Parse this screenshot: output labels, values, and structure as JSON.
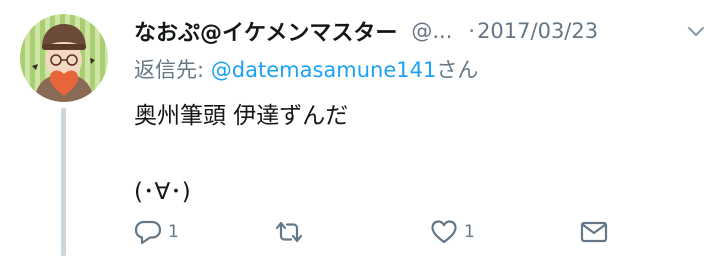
{
  "tweet": {
    "display_name": "なおぷ@イケメンマスター",
    "handle": "@...",
    "separator": "·",
    "date": "2017/03/23",
    "reply_prefix": "返信先: ",
    "reply_to": "@datemasamune141",
    "reply_suffix": "さん",
    "text_lines": [
      "奥州筆頭 伊達ずんだ",
      "(･∀･)"
    ]
  },
  "actions": {
    "reply_count": "1",
    "retweet_count": "",
    "like_count": "1"
  },
  "colors": {
    "text": "#14171a",
    "secondary": "#657786",
    "link": "#1da1f2",
    "thread_line": "#ccd6dd"
  },
  "icons": {
    "caret": "chevron-down-icon",
    "reply": "reply-icon",
    "retweet": "retweet-icon",
    "like": "heart-icon",
    "message": "envelope-icon"
  }
}
